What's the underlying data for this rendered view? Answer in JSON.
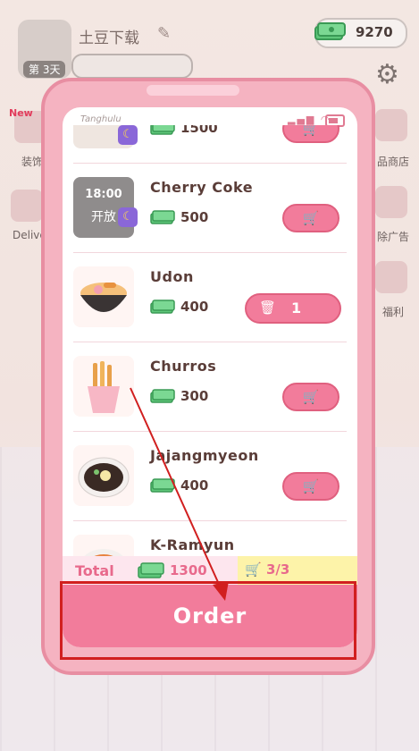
{
  "player": {
    "name": "土豆下载",
    "day_badge": "第 3天"
  },
  "money": {
    "balance": "9270"
  },
  "side_menu_left": [
    {
      "label": "装饰"
    },
    {
      "label": "Delive"
    }
  ],
  "side_menu_left_badge": "New",
  "side_menu_right": [
    {
      "label": "品商店"
    },
    {
      "label": "除广告"
    },
    {
      "label": "福利"
    }
  ],
  "phone": {
    "carrier": "Tanghulu"
  },
  "menu": {
    "items": [
      {
        "name": "",
        "price": "1500",
        "action": "cart"
      },
      {
        "name": "Cherry Coke",
        "price": "500",
        "locked_time": "18:00",
        "locked_label": "开放",
        "action": "cart"
      },
      {
        "name": "Udon",
        "price": "400",
        "action": "qty",
        "qty": "1"
      },
      {
        "name": "Churros",
        "price": "300",
        "action": "cart"
      },
      {
        "name": "Jajangmyeon",
        "price": "400",
        "action": "cart"
      },
      {
        "name": "K-Ramyun",
        "price": "",
        "action": "cart"
      }
    ]
  },
  "summary": {
    "total_label": "Total",
    "total_value": "1300",
    "cart_count": "3/3"
  },
  "order_button": {
    "label": "Order"
  },
  "colors": {
    "accent": "#f27c9b",
    "annotation": "#d11f1f"
  }
}
